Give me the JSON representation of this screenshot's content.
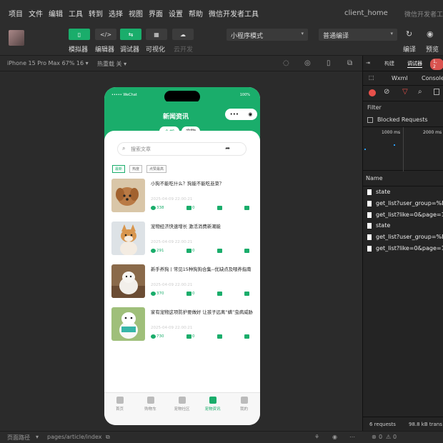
{
  "menu": {
    "items": [
      "项目",
      "文件",
      "编辑",
      "工具",
      "转到",
      "选择",
      "视图",
      "界面",
      "设置",
      "帮助",
      "微信开发者工具"
    ],
    "window_title": "client_home",
    "app_name": "微信开发者工具 St"
  },
  "toolbar": {
    "simulator": "模拟器",
    "editor": "编辑器",
    "debugger": "调试器",
    "visual": "可视化",
    "cloud": "云开发",
    "mode": "小程序模式",
    "compile_mode": "普通编译",
    "compile": "编译",
    "preview": "预览",
    "editor_icon": "</>"
  },
  "subbar": {
    "device": "iPhone 15 Pro Max 67% 16 ▾",
    "hot_reload": "热重载 关 ▾"
  },
  "phone": {
    "status": {
      "carrier": "••••• WeChat",
      "battery": "100%"
    },
    "nav_title": "新闻资讯",
    "tabs": [
      "全部",
      "宠物"
    ],
    "search_placeholder": "搜索文章",
    "filters": [
      "最新",
      "热度",
      "点赞最高"
    ],
    "articles": [
      {
        "title": "小狗不能吃什么？狗能不能吃韭菜？",
        "date": "2025-04-09 22:00:21",
        "views": "338",
        "likes": "0"
      },
      {
        "title": "宠物经济快速增长 激活消费新潮能",
        "date": "2025-04-09 22:00:21",
        "views": "291",
        "likes": "0"
      },
      {
        "title": "新手养狗丨常见15种狗狗合集--优缺点及喂养指南",
        "date": "2025-04-09 22:00:21",
        "views": "370",
        "likes": "0"
      },
      {
        "title": "家有宠物这项防护要做好 让孩子远离“螨”虫病威胁",
        "date": "2025-04-09 22:00:21",
        "views": "730",
        "likes": "0"
      }
    ],
    "tabbar": [
      "首页",
      "购物车",
      "宠物社区",
      "宠物资讯",
      "我的"
    ],
    "active_tab": "宠物资讯",
    "accent": "#1aad6b"
  },
  "devtools": {
    "tabs": [
      "构建",
      "调试器"
    ],
    "error_badge": "1, 2",
    "panel_tabs": [
      "Wxml",
      "Console"
    ],
    "filter_label": "Filter",
    "blocked_requests": "Blocked Requests",
    "timeline_ticks": [
      "1000 ms",
      "2000 ms"
    ],
    "name_header": "Name",
    "requests": [
      "state",
      "get_list?user_group=%E",
      "get_list?like=0&page=1",
      "state",
      "get_list?user_group=%E",
      "get_list?like=0&page=1"
    ],
    "summary_requests": "6 requests",
    "summary_transfer": "98.8 kB trans"
  },
  "bottom": {
    "path_label": "页面路径",
    "path": "pages/article/index",
    "errors": "0",
    "warnings": "0"
  }
}
